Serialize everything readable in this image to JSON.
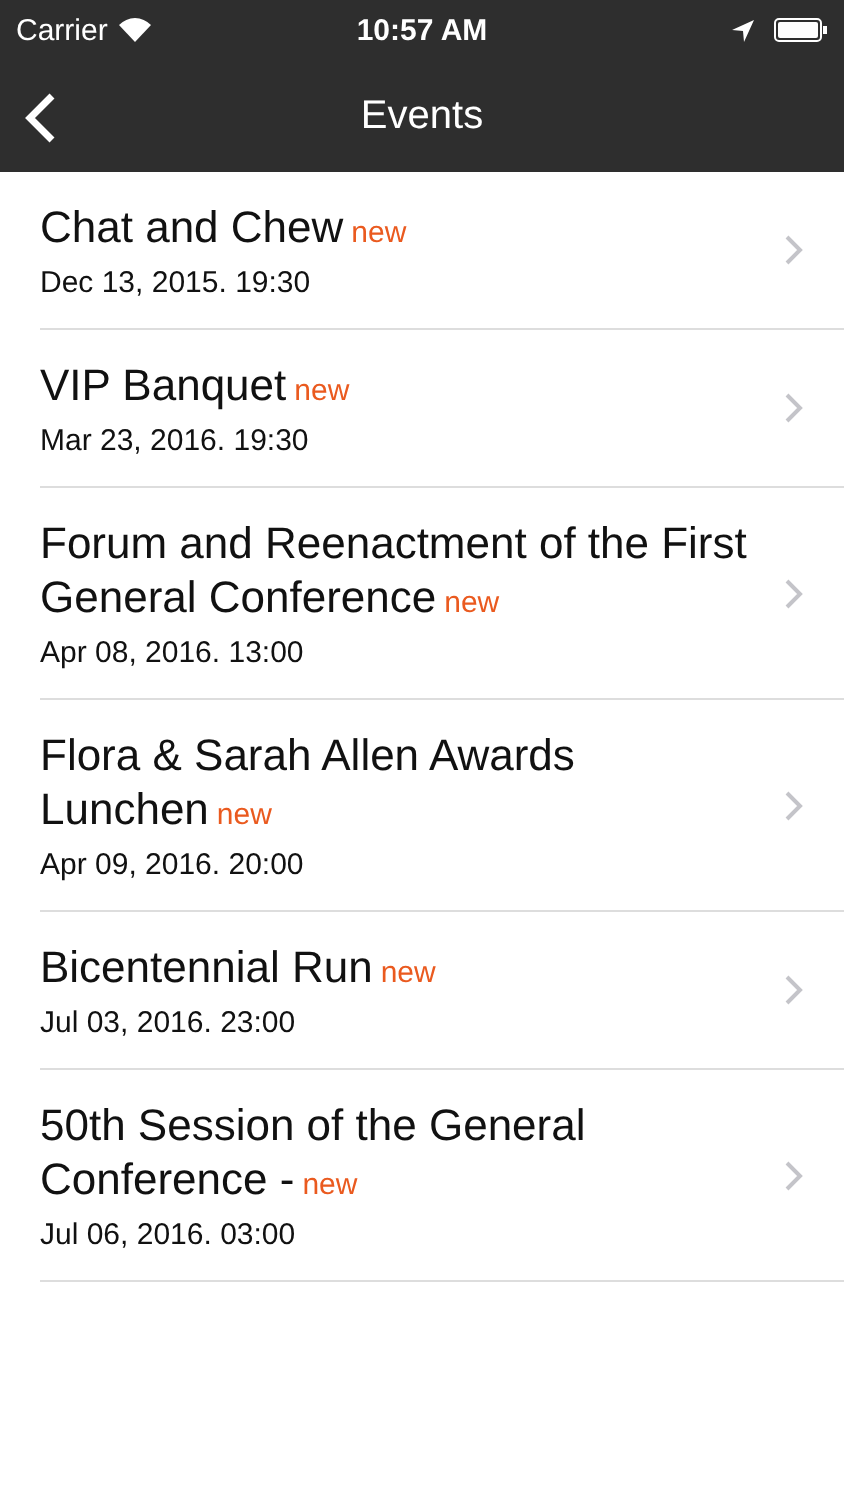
{
  "status_bar": {
    "carrier": "Carrier",
    "time": "10:57 AM"
  },
  "nav": {
    "title": "Events"
  },
  "events": [
    {
      "title": "Chat and Chew",
      "badge": "new",
      "date": "Dec 13, 2015. 19:30"
    },
    {
      "title": "VIP Banquet",
      "badge": "new",
      "date": "Mar 23, 2016. 19:30"
    },
    {
      "title": "Forum and Reenactment of the First General Conference",
      "badge": "new",
      "date": "Apr 08, 2016. 13:00"
    },
    {
      "title": "Flora & Sarah Allen Awards Lunchen",
      "badge": "new",
      "date": "Apr 09, 2016. 20:00"
    },
    {
      "title": "Bicentennial Run",
      "badge": "new",
      "date": "Jul 03, 2016. 23:00"
    },
    {
      "title": "50th Session of the General Conference -",
      "badge": "new",
      "date": "Jul 06, 2016. 03:00"
    }
  ]
}
